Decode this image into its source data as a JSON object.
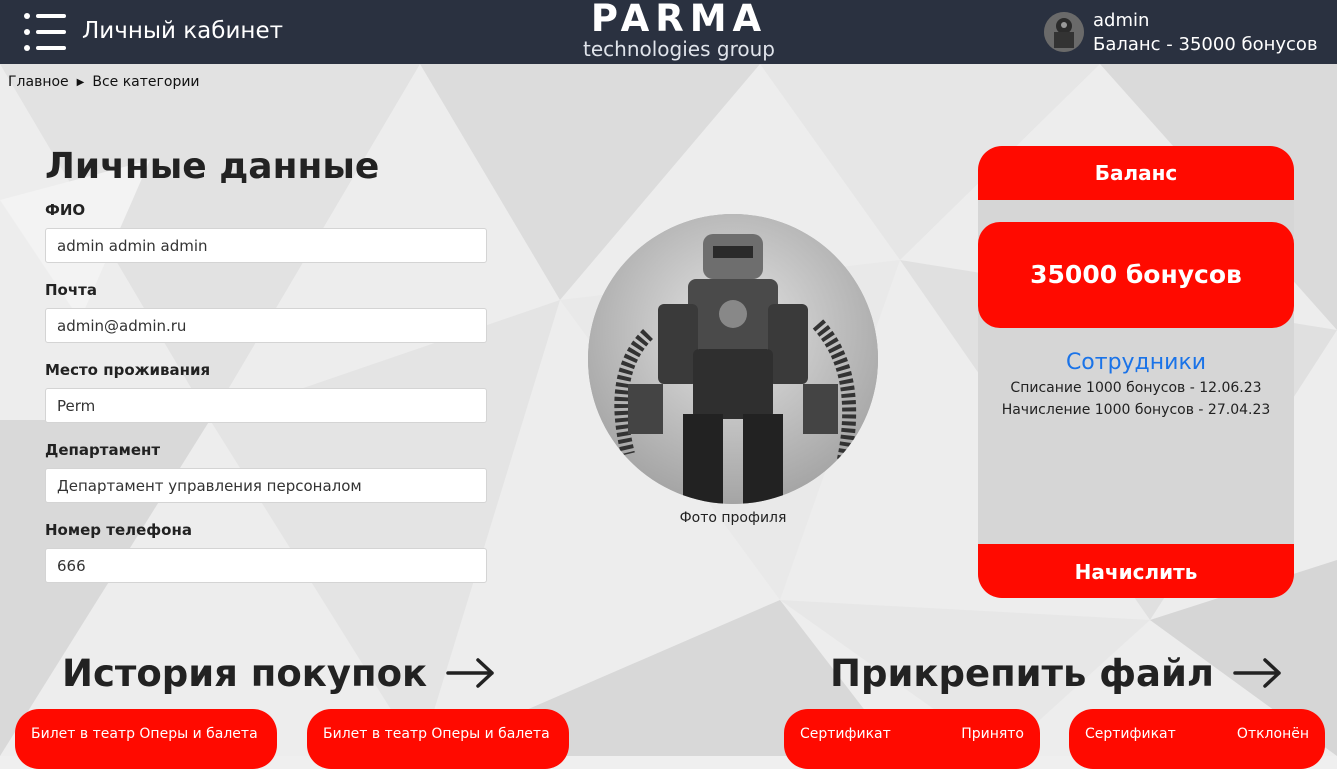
{
  "header": {
    "title": "Личный кабинет",
    "logo_main": "PARMA",
    "logo_sub": "technologies group",
    "user_name": "admin",
    "user_balance": "Баланс - 35000 бонусов"
  },
  "breadcrumb": {
    "home": "Главное",
    "current": "Все категории"
  },
  "personal": {
    "title": "Личные данные",
    "fields": [
      {
        "label": "ФИО",
        "value": "admin admin admin"
      },
      {
        "label": "Почта",
        "value": "admin@admin.ru"
      },
      {
        "label": "Место проживания",
        "value": "Perm"
      },
      {
        "label": "Департамент",
        "value": "Департамент управления персоналом"
      },
      {
        "label": "Номер телефона",
        "value": "666"
      }
    ]
  },
  "photo": {
    "caption": "Фото профиля"
  },
  "balance": {
    "title": "Баланс",
    "amount": "35000 бонусов",
    "employees_link": "Сотрудники",
    "transactions": [
      "Списание 1000 бонусов - 12.06.23",
      "Начисление 1000 бонусов - 27.04.23"
    ],
    "accrue_label": "Начислить"
  },
  "history": {
    "title": "История покупок",
    "items": [
      "Билет в театр Оперы и балета",
      "Билет в театр Оперы и балета"
    ]
  },
  "attach": {
    "title": "Прикрепить файл",
    "items": [
      {
        "name": "Сертификат",
        "status": "Принято"
      },
      {
        "name": "Сертификат",
        "status": "Отклонён"
      }
    ]
  },
  "colors": {
    "accent": "#ff0a00",
    "header_bg": "#2a3140",
    "link": "#1a73e8"
  },
  "icons": [
    "menu-icon",
    "arrow-right-icon",
    "breadcrumb-arrow-icon"
  ]
}
